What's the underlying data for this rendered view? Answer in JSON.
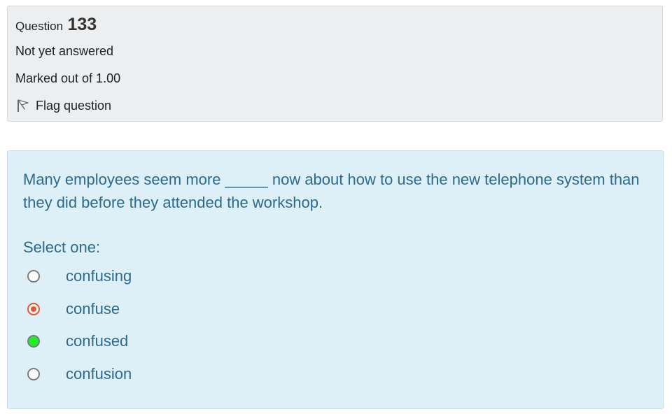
{
  "info": {
    "question_label": "Question",
    "question_number": "133",
    "status": "Not yet answered",
    "marks": "Marked out of 1.00",
    "flag_label": "Flag question"
  },
  "question": {
    "text": "Many employees seem more _____ now about how to use the new telephone system than they did before they attended the workshop.",
    "prompt": "Select one:",
    "options": [
      {
        "label": "confusing",
        "state": "unselected"
      },
      {
        "label": "confuse",
        "state": "selected"
      },
      {
        "label": "confused",
        "state": "highlighted-green"
      },
      {
        "label": "confusion",
        "state": "unselected"
      }
    ]
  },
  "colors": {
    "info_bg": "#eceef0",
    "question_bg": "#def0f7",
    "question_text": "#2b6a8e",
    "selected_radio": "#e6542a",
    "green_radio": "#22ee22"
  }
}
